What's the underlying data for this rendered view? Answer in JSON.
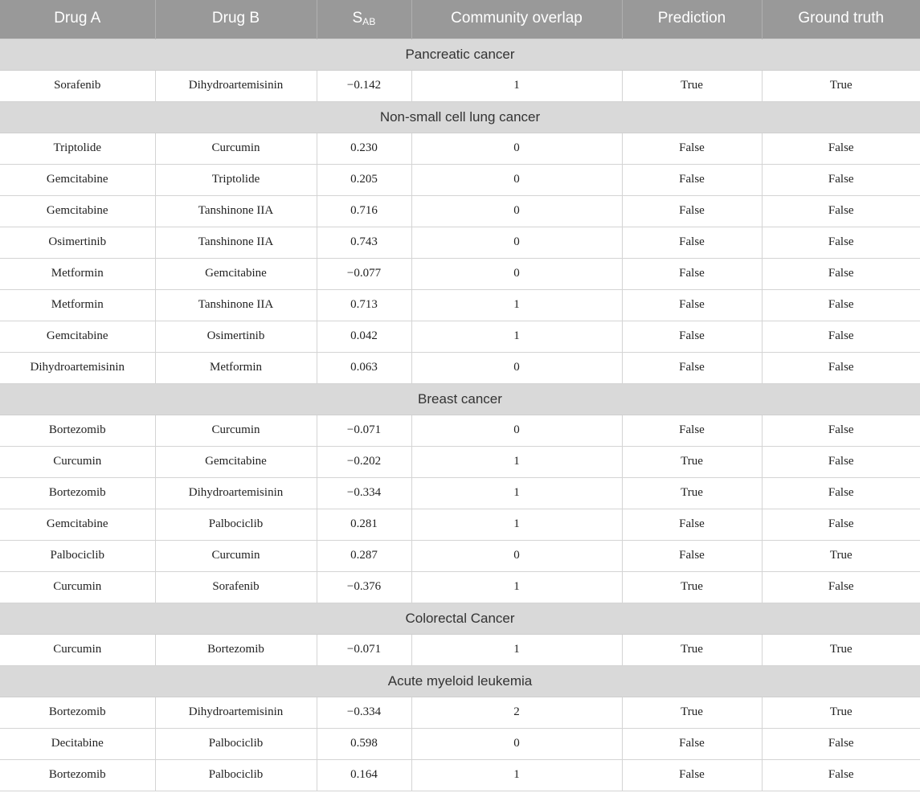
{
  "table": {
    "columns": [
      {
        "label": "Drug A",
        "key": "drug_a"
      },
      {
        "label": "Drug B",
        "key": "drug_b"
      },
      {
        "label": "S",
        "sub": "AB",
        "key": "sab"
      },
      {
        "label": "Community overlap",
        "key": "overlap"
      },
      {
        "label": "Prediction",
        "key": "prediction"
      },
      {
        "label": "Ground truth",
        "key": "ground_truth"
      }
    ],
    "colors": {
      "header_background": "#999999",
      "header_text": "#ffffff",
      "section_background": "#d9d9d9",
      "section_text": "#333333",
      "cell_background": "#ffffff",
      "cell_text": "#222222",
      "border": "#d4d4d4"
    },
    "sections": [
      {
        "title": "Pancreatic cancer",
        "rows": [
          [
            "Sorafenib",
            "Dihydroartemisinin",
            "−0.142",
            "1",
            "True",
            "True"
          ]
        ]
      },
      {
        "title": "Non-small cell lung cancer",
        "rows": [
          [
            "Triptolide",
            "Curcumin",
            "0.230",
            "0",
            "False",
            "False"
          ],
          [
            "Gemcitabine",
            "Triptolide",
            "0.205",
            "0",
            "False",
            "False"
          ],
          [
            "Gemcitabine",
            "Tanshinone IIA",
            "0.716",
            "0",
            "False",
            "False"
          ],
          [
            "Osimertinib",
            "Tanshinone IIA",
            "0.743",
            "0",
            "False",
            "False"
          ],
          [
            "Metformin",
            "Gemcitabine",
            "−0.077",
            "0",
            "False",
            "False"
          ],
          [
            "Metformin",
            "Tanshinone IIA",
            "0.713",
            "1",
            "False",
            "False"
          ],
          [
            "Gemcitabine",
            "Osimertinib",
            "0.042",
            "1",
            "False",
            "False"
          ],
          [
            "Dihydroartemisinin",
            "Metformin",
            "0.063",
            "0",
            "False",
            "False"
          ]
        ]
      },
      {
        "title": "Breast cancer",
        "rows": [
          [
            "Bortezomib",
            "Curcumin",
            "−0.071",
            "0",
            "False",
            "False"
          ],
          [
            "Curcumin",
            "Gemcitabine",
            "−0.202",
            "1",
            "True",
            "False"
          ],
          [
            "Bortezomib",
            "Dihydroartemisinin",
            "−0.334",
            "1",
            "True",
            "False"
          ],
          [
            "Gemcitabine",
            "Palbociclib",
            "0.281",
            "1",
            "False",
            "False"
          ],
          [
            "Palbociclib",
            "Curcumin",
            "0.287",
            "0",
            "False",
            "True"
          ],
          [
            "Curcumin",
            "Sorafenib",
            "−0.376",
            "1",
            "True",
            "False"
          ]
        ]
      },
      {
        "title": "Colorectal Cancer",
        "rows": [
          [
            "Curcumin",
            "Bortezomib",
            "−0.071",
            "1",
            "True",
            "True"
          ]
        ]
      },
      {
        "title": "Acute myeloid leukemia",
        "rows": [
          [
            "Bortezomib",
            "Dihydroartemisinin",
            "−0.334",
            "2",
            "True",
            "True"
          ],
          [
            "Decitabine",
            "Palbociclib",
            "0.598",
            "0",
            "False",
            "False"
          ],
          [
            "Bortezomib",
            "Palbociclib",
            "0.164",
            "1",
            "False",
            "False"
          ]
        ]
      }
    ]
  }
}
